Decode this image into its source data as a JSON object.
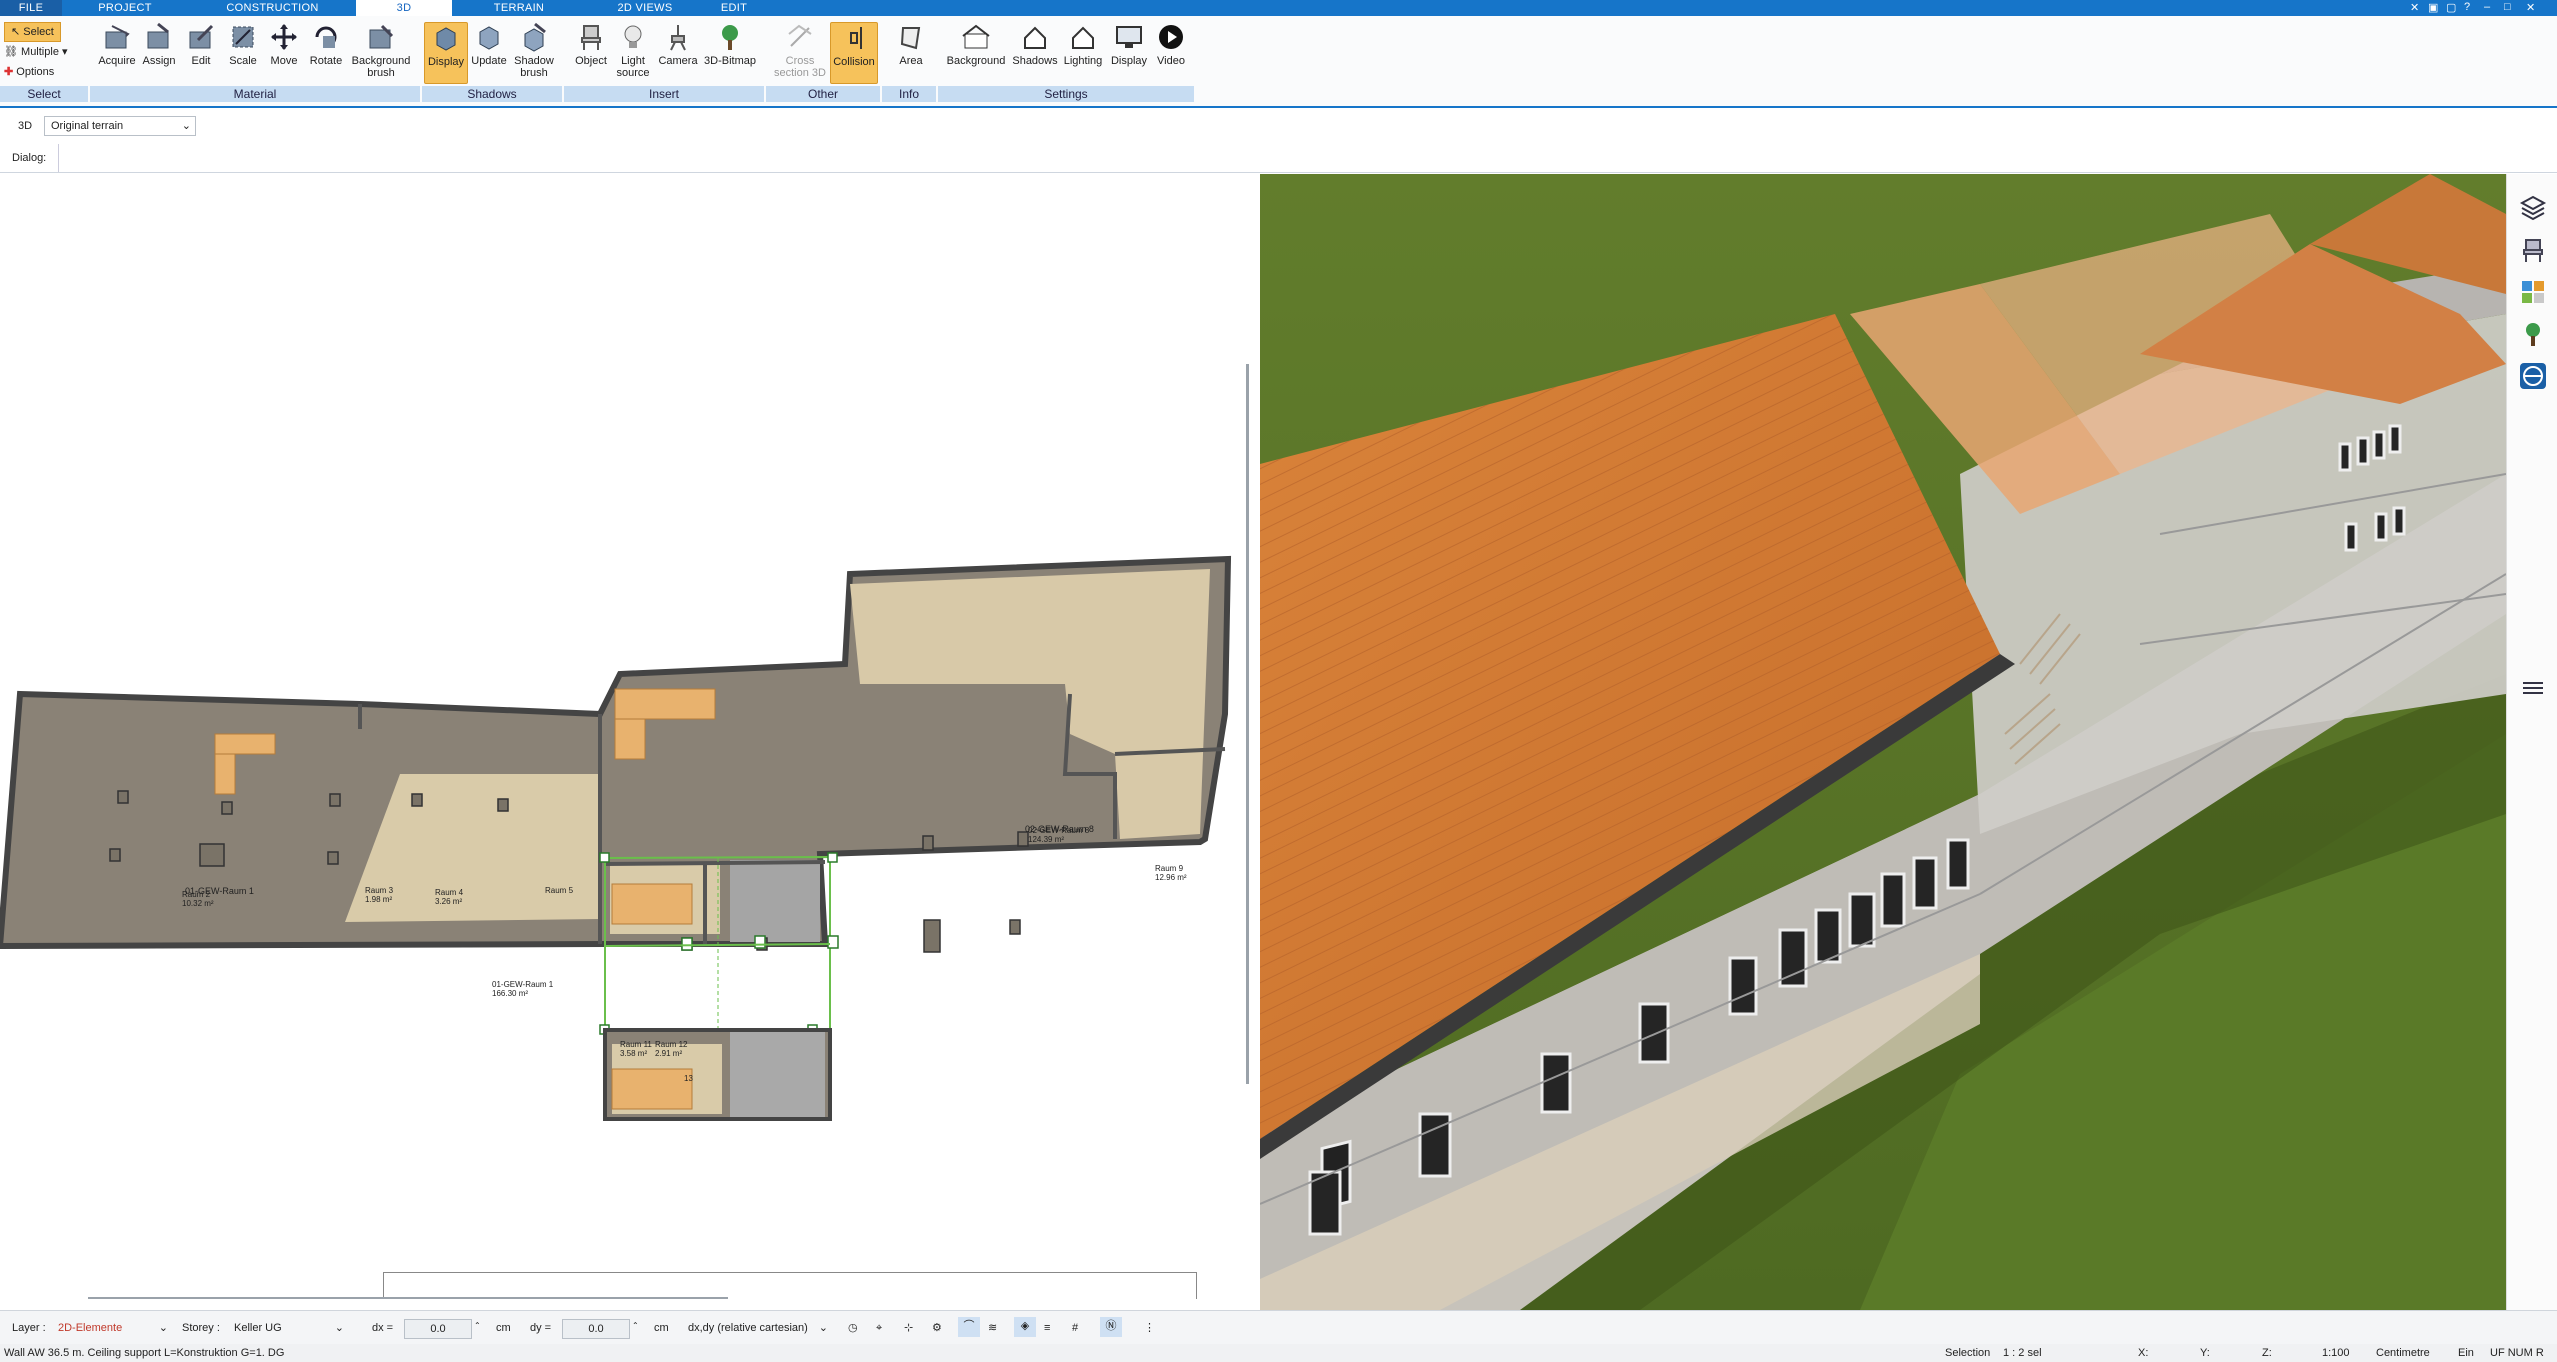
{
  "menubar": {
    "tabs": [
      {
        "label": "FILE",
        "active": false
      },
      {
        "label": "PROJECT",
        "active": false
      },
      {
        "label": "CONSTRUCTION",
        "active": false
      },
      {
        "label": "3D",
        "active": true
      },
      {
        "label": "TERRAIN",
        "active": false
      },
      {
        "label": "2D VIEWS",
        "active": false
      },
      {
        "label": "EDIT",
        "active": false
      }
    ]
  },
  "ribbon": {
    "select": {
      "select_label": "Select",
      "multiple_label": "Multiple",
      "options_label": "Options",
      "group": "Select"
    },
    "material": {
      "group": "Material",
      "buttons": [
        "Acquire",
        "Assign",
        "Edit",
        "Scale",
        "Move",
        "Rotate",
        "Background brush"
      ]
    },
    "shadows": {
      "group": "Shadows",
      "buttons": [
        "Display",
        "Update",
        "Shadow brush"
      ]
    },
    "insert": {
      "group": "Insert",
      "buttons": [
        "Object",
        "Light source",
        "Camera",
        "3D-Bitmap"
      ]
    },
    "other": {
      "group": "Other",
      "buttons": [
        "Cross section 3D",
        "Collision"
      ]
    },
    "info": {
      "group": "Info",
      "buttons": [
        "Area"
      ]
    },
    "settings": {
      "group": "Settings",
      "buttons": [
        "Background",
        "Shadows",
        "Lighting",
        "Display",
        "Video"
      ]
    }
  },
  "toolrow": {
    "mode": "3D",
    "terrain": "Original terrain"
  },
  "dialog": {
    "label": "Dialog:"
  },
  "plan": {
    "rooms": [
      {
        "name": "Raum 2",
        "area": "10.32 m²"
      },
      {
        "name": "Raum 3",
        "area": "1.98 m²"
      },
      {
        "name": "Raum 4",
        "area": "3.26 m²"
      },
      {
        "name": "Raum 5",
        "area": ""
      },
      {
        "name": "01-GEW-Raum 1",
        "area": "166.30 m²"
      },
      {
        "name": "02-GEW-Raum 8",
        "area": "124.39 m²"
      },
      {
        "name": "Raum 9",
        "area": "12.96 m²"
      },
      {
        "name": "Raum 11",
        "area": "3.58 m²"
      },
      {
        "name": "Raum 12",
        "area": "2.91 m²"
      },
      {
        "name": "13",
        "area": ""
      }
    ]
  },
  "status": {
    "layer_label": "Layer :",
    "layer_value": "2D-Elemente",
    "storey_label": "Storey :",
    "storey_value": "Keller UG",
    "dx_label": "dx =",
    "dx_value": "0.0",
    "dx_unit": "cm",
    "dy_label": "dy =",
    "dy_value": "0.0",
    "dy_unit": "cm",
    "coord_mode": "dx,dy (relative cartesian)"
  },
  "bottom": {
    "info": "Wall AW 36.5 m. Ceiling support L=Konstruktion G=1. DG",
    "selection": "Selection",
    "sel_count": "1 : 2 sel",
    "x_label": "X:",
    "y_label": "Y:",
    "z_label": "Z:",
    "scale": "1:100",
    "unit": "Centimetre",
    "ein": "Ein",
    "flags": "UF NUM R"
  },
  "colors": {
    "accent": "#1675c9",
    "active_tool": "#f6c25b",
    "roof": "#d77f35",
    "grass": "#5d7a2a"
  }
}
